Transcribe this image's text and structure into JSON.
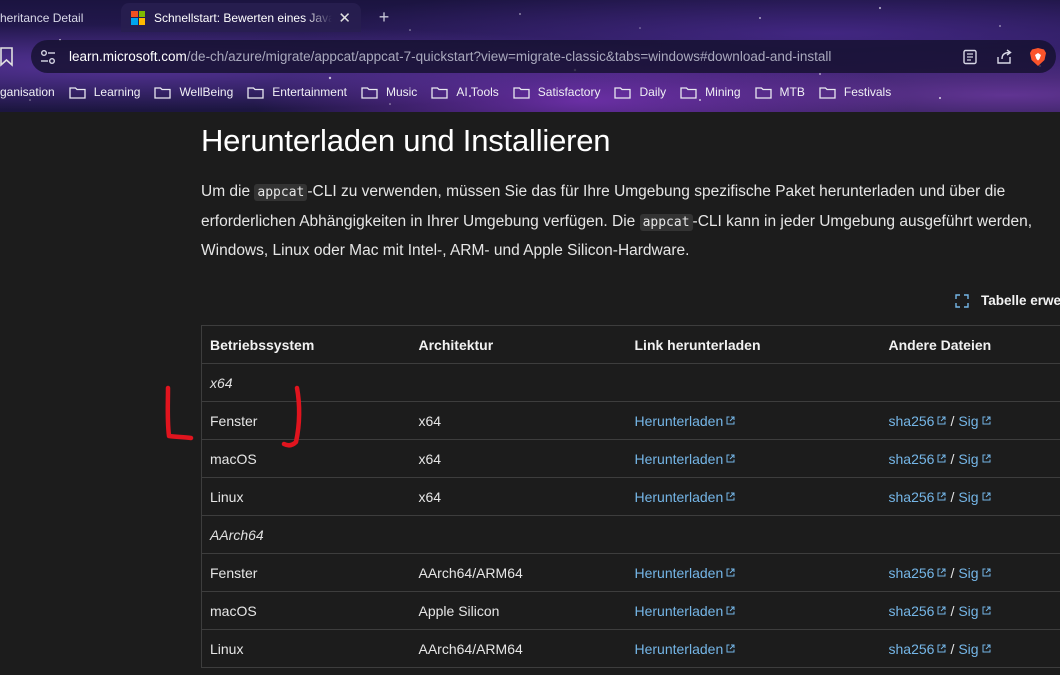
{
  "browser": {
    "tabs": [
      {
        "title": "heritance Detail",
        "active": false
      },
      {
        "title": "Schnellstart: Bewerten eines Java",
        "active": true
      }
    ],
    "new_tab_label": "+",
    "close_label": "✕",
    "url": {
      "host": "learn.microsoft.com",
      "path": "/de-ch/azure/migrate/appcat/appcat-7-quickstart?view=migrate-classic&tabs=windows#download-and-install"
    },
    "bookmarks": [
      "rganisation",
      "Learning",
      "WellBeing",
      "Entertainment",
      "Music",
      "AI Tools",
      "Satisfactory",
      "Daily",
      "Mining",
      "MTB",
      "Festivals"
    ]
  },
  "page": {
    "heading": "Herunterladen und Installieren",
    "intro": {
      "l1_a": "Um die ",
      "code1": "appcat",
      "l1_b": "-CLI zu verwenden, müssen Sie das für Ihre Umgebung spezifische Paket herunterladen und über die",
      "l2_a": "erforderlichen Abhängigkeiten in Ihrer Umgebung verfügen. Die ",
      "code2": "appcat",
      "l2_b": "-CLI kann in jeder Umgebung ausgeführt werden,",
      "l3": "Windows, Linux oder Mac mit Intel-, ARM- und Apple Silicon-Hardware."
    },
    "expand_label": "Tabelle erwe",
    "table": {
      "headers": [
        "Betriebssystem",
        "Architektur",
        "Link herunterladen",
        "Andere Dateien"
      ],
      "groups": [
        "x64",
        "AArch64"
      ],
      "rows": [
        {
          "os": "Fenster",
          "arch": "x64",
          "link": "Herunterladen",
          "sha": "sha256",
          "sig": "Sig"
        },
        {
          "os": "macOS",
          "arch": "x64",
          "link": "Herunterladen",
          "sha": "sha256",
          "sig": "Sig"
        },
        {
          "os": "Linux",
          "arch": "x64",
          "link": "Herunterladen",
          "sha": "sha256",
          "sig": "Sig"
        },
        {
          "os": "Fenster",
          "arch": "AArch64/ARM64",
          "link": "Herunterladen",
          "sha": "sha256",
          "sig": "Sig"
        },
        {
          "os": "macOS",
          "arch": "Apple Silicon",
          "link": "Herunterladen",
          "sha": "sha256",
          "sig": "Sig"
        },
        {
          "os": "Linux",
          "arch": "AArch64/ARM64",
          "link": "Herunterladen",
          "sha": "sha256",
          "sig": "Sig"
        }
      ],
      "separator": "/"
    }
  },
  "colors": {
    "link": "#75b6e7",
    "annotation": "#e0141e",
    "background": "#1c1c1c"
  }
}
